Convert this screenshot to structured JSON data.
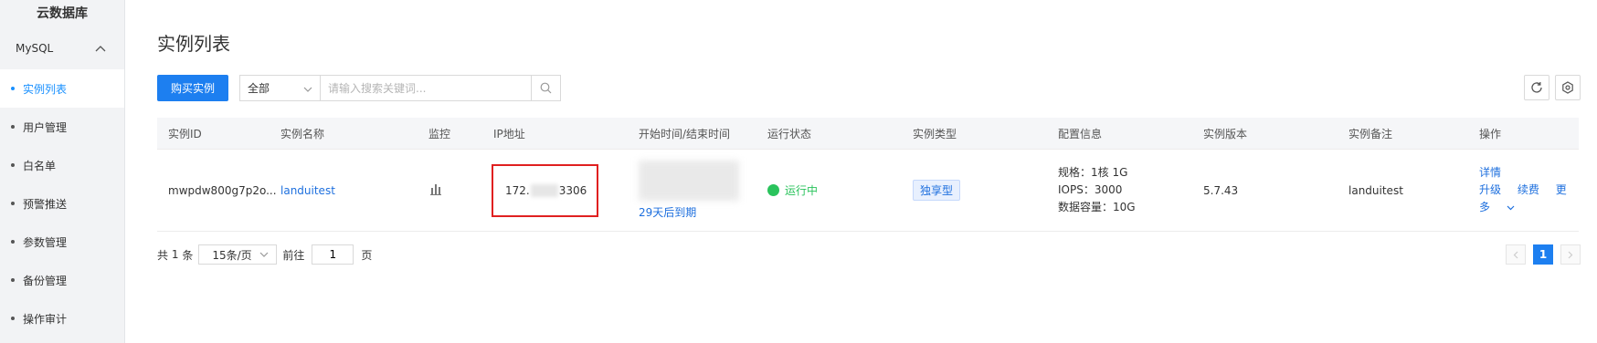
{
  "sidebar": {
    "title": "云数据库",
    "group": "MySQL",
    "items": [
      {
        "label": "实例列表"
      },
      {
        "label": "用户管理"
      },
      {
        "label": "白名单"
      },
      {
        "label": "预警推送"
      },
      {
        "label": "参数管理"
      },
      {
        "label": "备份管理"
      },
      {
        "label": "操作审计"
      }
    ],
    "active_index": 0
  },
  "page": {
    "title": "实例列表"
  },
  "toolbar": {
    "buy_label": "购买实例",
    "select_value": "全部",
    "search_placeholder": "请输入搜索关键词..."
  },
  "table": {
    "headers": [
      "实例ID",
      "实例名称",
      "监控",
      "IP地址",
      "开始时间/结束时间",
      "运行状态",
      "实例类型",
      "配置信息",
      "实例版本",
      "实例备注",
      "操作"
    ],
    "rows": [
      {
        "id": "mwpdw800g7p2o...",
        "name": "landuitest",
        "ip_prefix": "172.",
        "ip_suffix": "3306",
        "expire": "29天后到期",
        "status": "运行中",
        "type": "独享型",
        "config": [
          "规格：1核 1G",
          "IOPS：3000",
          "数据容量：10G"
        ],
        "version": "5.7.43",
        "remark": "landuitest",
        "ops": {
          "detail": "详情",
          "upgrade": "升级",
          "renew": "续费",
          "more": "更多"
        }
      }
    ]
  },
  "pagination": {
    "total_prefix": "共",
    "total": "1",
    "total_suffix": "条",
    "page_size": "15条/页",
    "goto_label": "前往",
    "goto_value": "1",
    "page_suffix": "页",
    "current_page": "1"
  },
  "colors": {
    "primary": "#1d7ff0",
    "running": "#2ac35c",
    "highlight_box": "#e02020"
  }
}
